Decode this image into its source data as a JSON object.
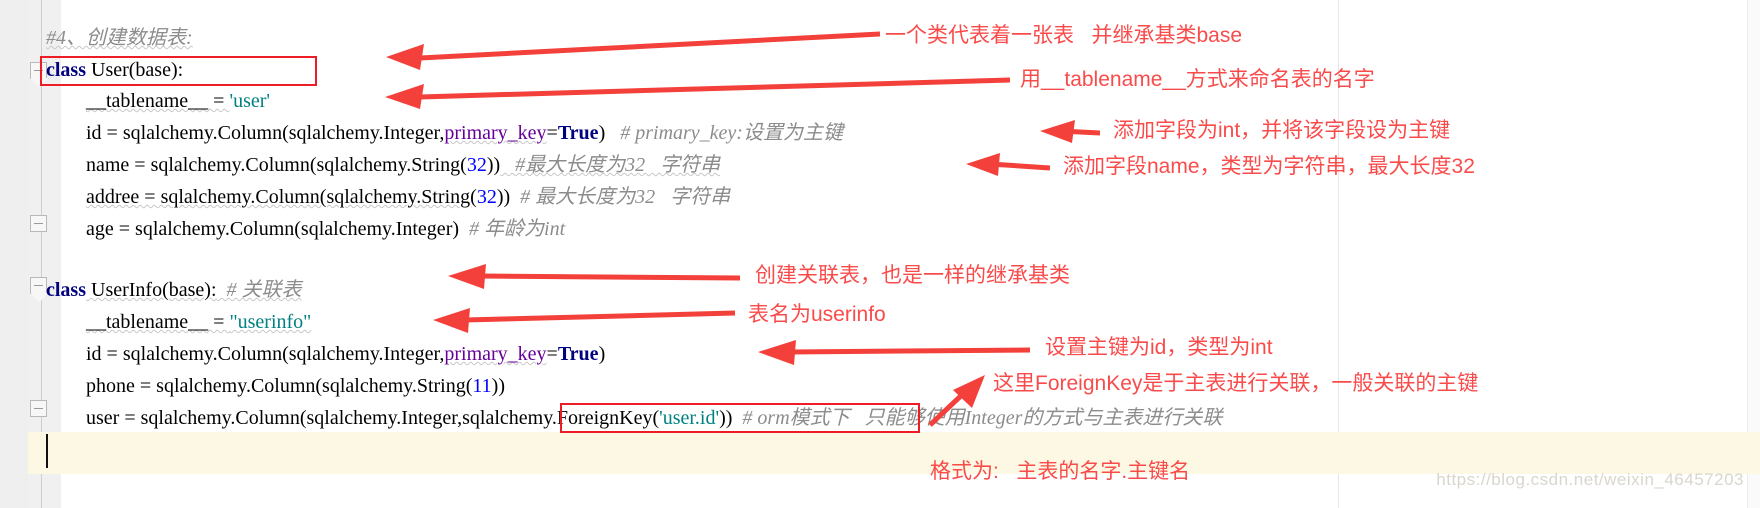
{
  "editor": {
    "language": "python",
    "accent_red": "#ee1c25",
    "annotation_red": "#fa4b4b",
    "comment_gray": "#8c8c8c",
    "keyword_navy": "#000080",
    "string_teal": "#008080",
    "number_blue": "#0000ff",
    "named_arg_purple": "#660099",
    "current_line_bg": "#fcf8e4",
    "gutter_bg": "#efefef"
  },
  "code": {
    "lines": [
      {
        "id": "line-header-comment",
        "indent": 0,
        "tokens": [
          {
            "kind": "comment",
            "text": "#4、创建数据表:"
          }
        ]
      },
      {
        "id": "line-class-user",
        "indent": 0,
        "tokens": [
          {
            "kind": "keyword",
            "text": "class"
          },
          {
            "kind": "plain",
            "text": " User(base):"
          }
        ]
      },
      {
        "id": "line-user-tablename",
        "indent": 1,
        "tokens": [
          {
            "kind": "plain",
            "text": "__tablename__ = "
          },
          {
            "kind": "string",
            "text": "'user'"
          }
        ]
      },
      {
        "id": "line-user-id",
        "indent": 1,
        "tokens": [
          {
            "kind": "plain",
            "text": "id = sqlalchemy.Column(sqlalchemy.Integer,"
          },
          {
            "kind": "named",
            "text": "primary_key"
          },
          {
            "kind": "plain",
            "text": "="
          },
          {
            "kind": "keyword",
            "text": "True"
          },
          {
            "kind": "plain",
            "text": ")"
          },
          {
            "kind": "comment",
            "text": "   # primary_key:设置为主键"
          }
        ]
      },
      {
        "id": "line-user-name",
        "indent": 1,
        "tokens": [
          {
            "kind": "plain",
            "text": "name = sqlalchemy.Column(sqlalchemy.String("
          },
          {
            "kind": "number",
            "text": "32"
          },
          {
            "kind": "plain",
            "text": "))"
          },
          {
            "kind": "comment",
            "text": "   #最大长度为32   字符串"
          }
        ]
      },
      {
        "id": "line-user-addree",
        "indent": 1,
        "tokens": [
          {
            "kind": "plain",
            "text": "addree = sqlalchemy.Column(sqlalchemy.String("
          },
          {
            "kind": "number",
            "text": "32"
          },
          {
            "kind": "plain",
            "text": "))"
          },
          {
            "kind": "comment",
            "text": "  # 最大长度为32   字符串"
          }
        ]
      },
      {
        "id": "line-user-age",
        "indent": 1,
        "tokens": [
          {
            "kind": "plain",
            "text": "age = sqlalchemy.Column(sqlalchemy.Integer)"
          },
          {
            "kind": "comment",
            "text": "  # 年龄为int"
          }
        ]
      },
      {
        "id": "line-class-userinfo",
        "indent": 0,
        "tokens": [
          {
            "kind": "keyword",
            "text": "class"
          },
          {
            "kind": "plain",
            "text": " UserInfo(base):"
          },
          {
            "kind": "comment",
            "text": "  # 关联表"
          }
        ]
      },
      {
        "id": "line-userinfo-tablename",
        "indent": 1,
        "tokens": [
          {
            "kind": "plain",
            "text": "__tablename__ = "
          },
          {
            "kind": "string",
            "text": "\"userinfo\""
          }
        ]
      },
      {
        "id": "line-userinfo-id",
        "indent": 1,
        "tokens": [
          {
            "kind": "plain",
            "text": "id = sqlalchemy.Column(sqlalchemy.Integer,"
          },
          {
            "kind": "named",
            "text": "primary_key"
          },
          {
            "kind": "plain",
            "text": "="
          },
          {
            "kind": "keyword",
            "text": "True"
          },
          {
            "kind": "plain",
            "text": ")"
          }
        ]
      },
      {
        "id": "line-userinfo-phone",
        "indent": 1,
        "tokens": [
          {
            "kind": "plain",
            "text": "phone = sqlalchemy.Column(sqlalchemy.String("
          },
          {
            "kind": "number",
            "text": "11"
          },
          {
            "kind": "plain",
            "text": "))"
          }
        ]
      },
      {
        "id": "line-userinfo-user",
        "indent": 1,
        "tokens": [
          {
            "kind": "plain",
            "text": "user = sqlalchemy.Column(sqlalchemy.Integer,sqlalchemy.ForeignKey("
          },
          {
            "kind": "string",
            "text": "'user.id'"
          },
          {
            "kind": "plain",
            "text": "))"
          },
          {
            "kind": "comment",
            "text": "  # orm模式下   只能够使用Integer的方式与主表进行关联"
          }
        ]
      }
    ],
    "rendered": {
      "l0": "#4、创建数据表:",
      "l1_kw": "class",
      "l1_rest": " User(base):",
      "l2_plain": "__tablename__ = ",
      "l2_str": "'user'",
      "l3_a": "id = sqlalchemy.Column(sqlalchemy.Integer,",
      "l3_named": "primary_key",
      "l3_eq": "=",
      "l3_true": "True",
      "l3_close": ")",
      "l3_cmt": "   # primary_key:设置为主键",
      "l4_a": "name = sqlalchemy.Column(sqlalchemy.String(",
      "l4_num": "32",
      "l4_close": "))",
      "l4_cmt": "   #最大长度为32   字符串",
      "l5_a": "addree = sqlalchemy.Column(sqlalchemy.String(",
      "l5_num": "32",
      "l5_close": "))",
      "l5_cmt": "  # 最大长度为32   字符串",
      "l6_a": "age = sqlalchemy.Column(sqlalchemy.Integer)",
      "l6_cmt": "  # 年龄为int",
      "l7_kw": "class",
      "l7_rest": " UserInfo(base):",
      "l7_cmt": "  # 关联表",
      "l8_plain": "__tablename__ = ",
      "l8_str": "\"userinfo\"",
      "l9_a": "id = sqlalchemy.Column(sqlalchemy.Integer,",
      "l9_named": "primary_key",
      "l9_eq": "=",
      "l9_true": "True",
      "l9_close": ")",
      "l10_a": "phone = sqlalchemy.Column(sqlalchemy.String(",
      "l10_num": "11",
      "l10_close": "))",
      "l11_a": "user = sqlalchemy.Column(sqlalchemy.Integer,",
      "l11_boxed_a": "sqlalchemy.ForeignKey(",
      "l11_boxed_str": "'user.id'",
      "l11_boxed_b": "))",
      "l11_cmt": "  # orm模式下   只能够使用Integer的方式与主表进行关联"
    }
  },
  "annotations": [
    {
      "id": "ann-class-table",
      "text": "一个类代表着一张表   并继承基类base"
    },
    {
      "id": "ann-tablename",
      "text": "用__tablename__方式来命名表的名字"
    },
    {
      "id": "ann-id-int-pk",
      "text": "添加字段为int，并将该字段设为主键"
    },
    {
      "id": "ann-name-string",
      "text": "添加字段name，类型为字符串，最大长度32"
    },
    {
      "id": "ann-related-table",
      "text": "创建关联表，也是一样的继承基类"
    },
    {
      "id": "ann-table-userinfo",
      "text": "表名为userinfo"
    },
    {
      "id": "ann-pk-id-int",
      "text": "设置主键为id，类型为int"
    },
    {
      "id": "ann-foreignkey",
      "text": "这里ForeignKey是于主表进行关联，一般关联的主键"
    },
    {
      "id": "ann-format",
      "text": "格式为:   主表的名字.主键名"
    }
  ],
  "watermark": {
    "text": "https://blog.csdn.net/weixin_46457203"
  }
}
